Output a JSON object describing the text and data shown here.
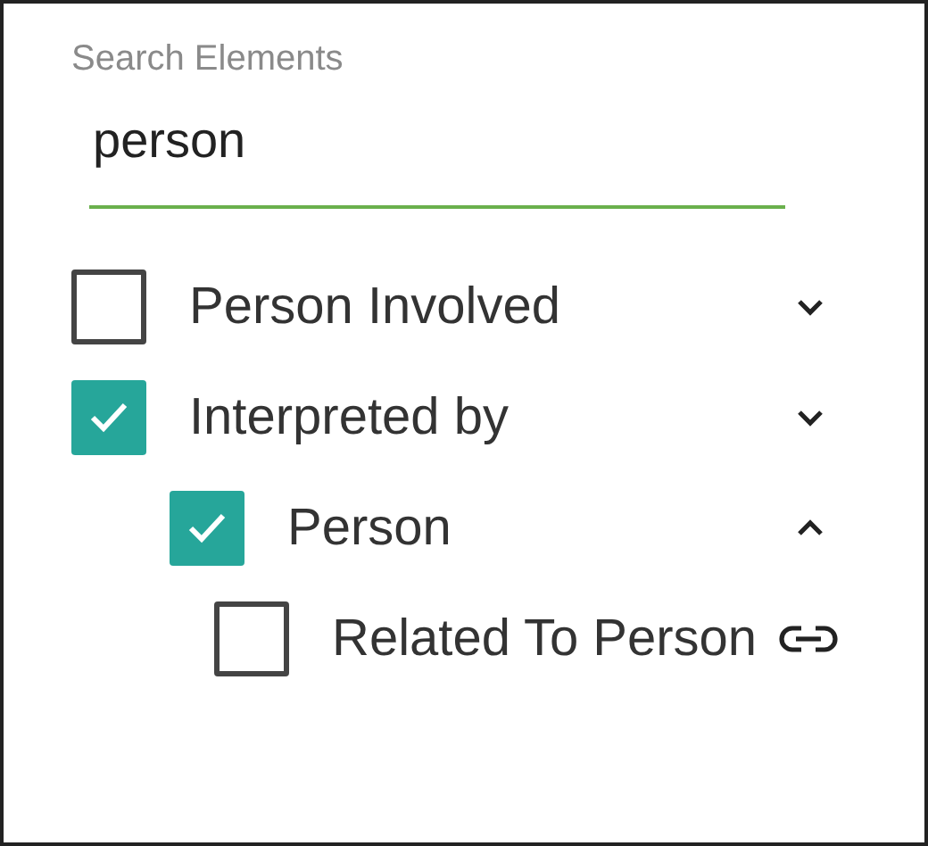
{
  "search": {
    "label": "Search Elements",
    "value": "person"
  },
  "tree": [
    {
      "label": "Person Involved",
      "checked": false,
      "kind": "expandable",
      "expanded": false
    },
    {
      "label": "Interpreted by",
      "checked": true,
      "kind": "expandable",
      "expanded": false,
      "children": [
        {
          "label": "Person",
          "checked": true,
          "kind": "expandable",
          "expanded": true,
          "children": [
            {
              "label": "Related To Person",
              "checked": false,
              "kind": "link"
            }
          ]
        }
      ]
    }
  ]
}
